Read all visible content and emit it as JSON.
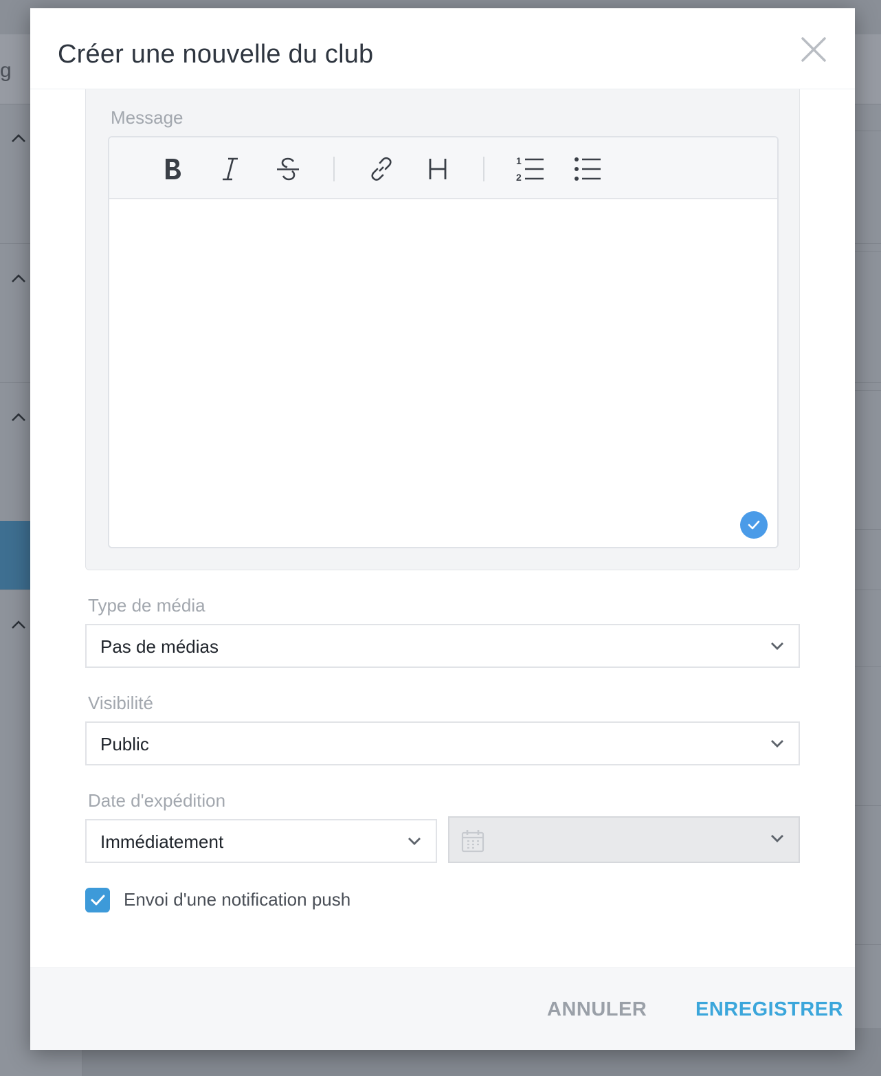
{
  "background": {
    "partial_text": "g"
  },
  "modal": {
    "title": "Créer une nouvelle du club",
    "close_icon": "close-icon",
    "message": {
      "label": "Message",
      "toolbar": [
        "bold-icon",
        "italic-icon",
        "strikethrough-icon",
        "link-icon",
        "heading-icon",
        "ordered-list-icon",
        "unordered-list-icon"
      ],
      "content": ""
    },
    "media_type": {
      "label": "Type de média",
      "value": "Pas de médias"
    },
    "visibility": {
      "label": "Visibilité",
      "value": "Public"
    },
    "send_date": {
      "label": "Date d'expédition",
      "value": "Immédiatement",
      "date_value": ""
    },
    "push_notification": {
      "label": "Envoi d'une notification push",
      "checked": true
    },
    "footer": {
      "cancel_label": "ANNULER",
      "save_label": "ENREGISTRER"
    }
  },
  "colors": {
    "accent": "#3ba6db",
    "checkbox": "#3d9ad9",
    "valid_badge": "#4a9be8",
    "overlay": "#8e939b"
  }
}
